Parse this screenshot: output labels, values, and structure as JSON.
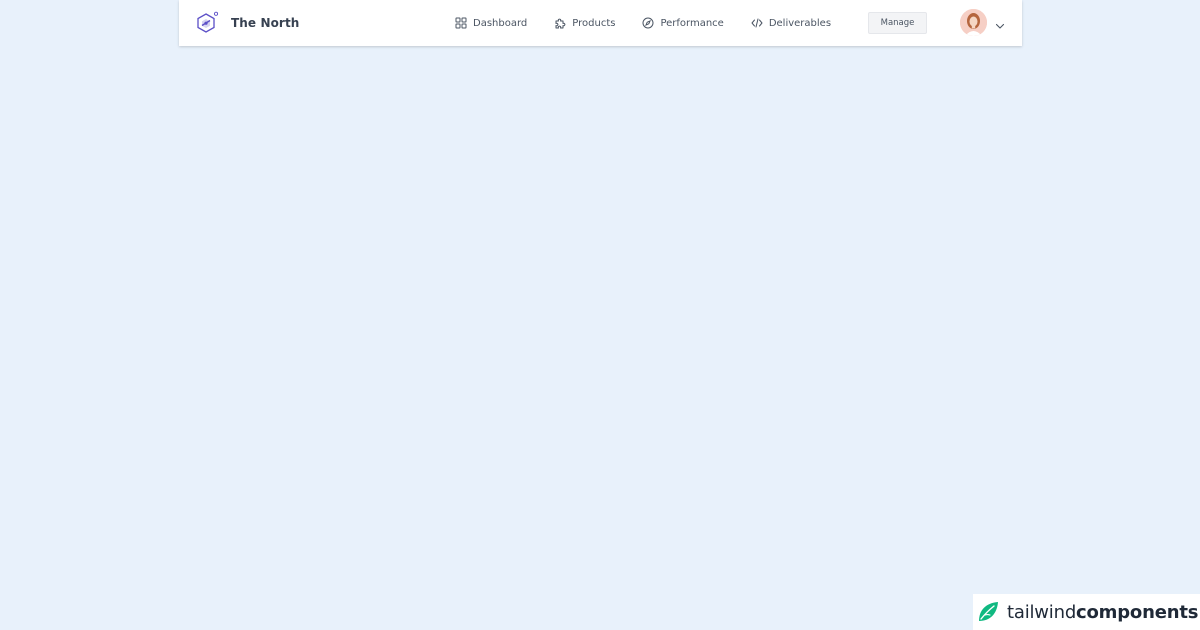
{
  "brand": {
    "name": "The North",
    "logo_icon": "hexagon-logo-icon"
  },
  "nav": {
    "items": [
      {
        "label": "Dashboard",
        "icon": "grid-icon"
      },
      {
        "label": "Products",
        "icon": "puzzle-icon"
      },
      {
        "label": "Performance",
        "icon": "compass-icon"
      },
      {
        "label": "Deliverables",
        "icon": "code-icon"
      }
    ]
  },
  "actions": {
    "manage_label": "Manage"
  },
  "user": {
    "avatar_icon": "user-avatar",
    "menu_icon": "chevron-down-icon"
  },
  "watermark": {
    "part1": "tailwind",
    "part2": "components",
    "icon": "leaf-icon"
  },
  "colors": {
    "page_background": "#e8f1fb",
    "navbar_background": "#ffffff",
    "brand_accent": "#5b4fc7",
    "text": "#4b5563",
    "watermark_green": "#10b981"
  }
}
